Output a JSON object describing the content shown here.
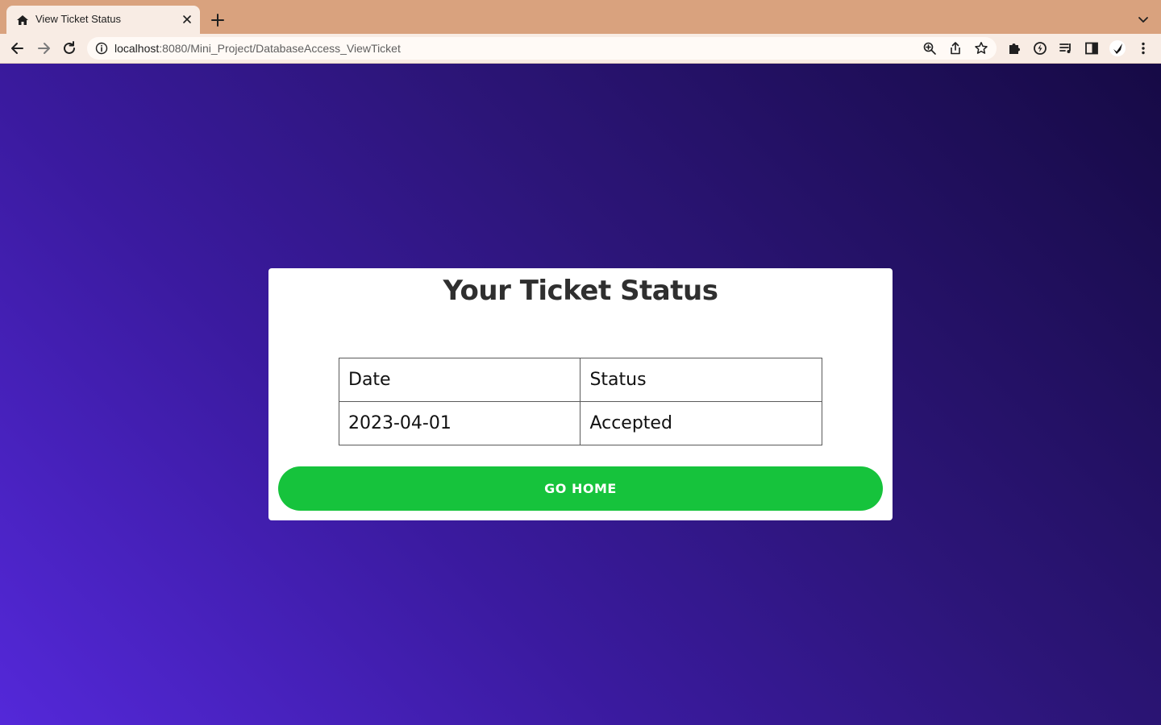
{
  "browser": {
    "tab_title": "View Ticket Status",
    "url_host": "localhost",
    "url_path": ":8080/Mini_Project/DatabaseAccess_ViewTicket"
  },
  "icons": {
    "tab_favicon": "home-icon",
    "tab_close": "close-icon",
    "new_tab": "plus-icon",
    "tab_menu": "chevron-down-icon",
    "back": "arrow-left-icon",
    "forward": "arrow-right-icon",
    "reload": "reload-icon",
    "site_info": "info-icon",
    "zoom": "zoom-icon",
    "share": "share-icon",
    "bookmark": "star-icon",
    "extensions": "puzzle-icon",
    "performance": "bolt-icon",
    "media": "media-queue-icon",
    "side_panel": "side-panel-icon",
    "profile": "avatar",
    "menu": "more-vertical-icon"
  },
  "page": {
    "title": "Your Ticket Status",
    "table": {
      "headers": [
        "Date",
        "Status"
      ],
      "rows": [
        [
          "2023-04-01",
          "Accepted"
        ]
      ]
    },
    "home_button": "GO HOME"
  },
  "colors": {
    "tab_strip": "#d9a27e",
    "toolbar": "#f8ece4",
    "background_gradient_start": "#5428d9",
    "background_gradient_end": "#160a45",
    "card": "#ffffff",
    "button": "#16c33c",
    "title_text": "#2f2f2f"
  }
}
